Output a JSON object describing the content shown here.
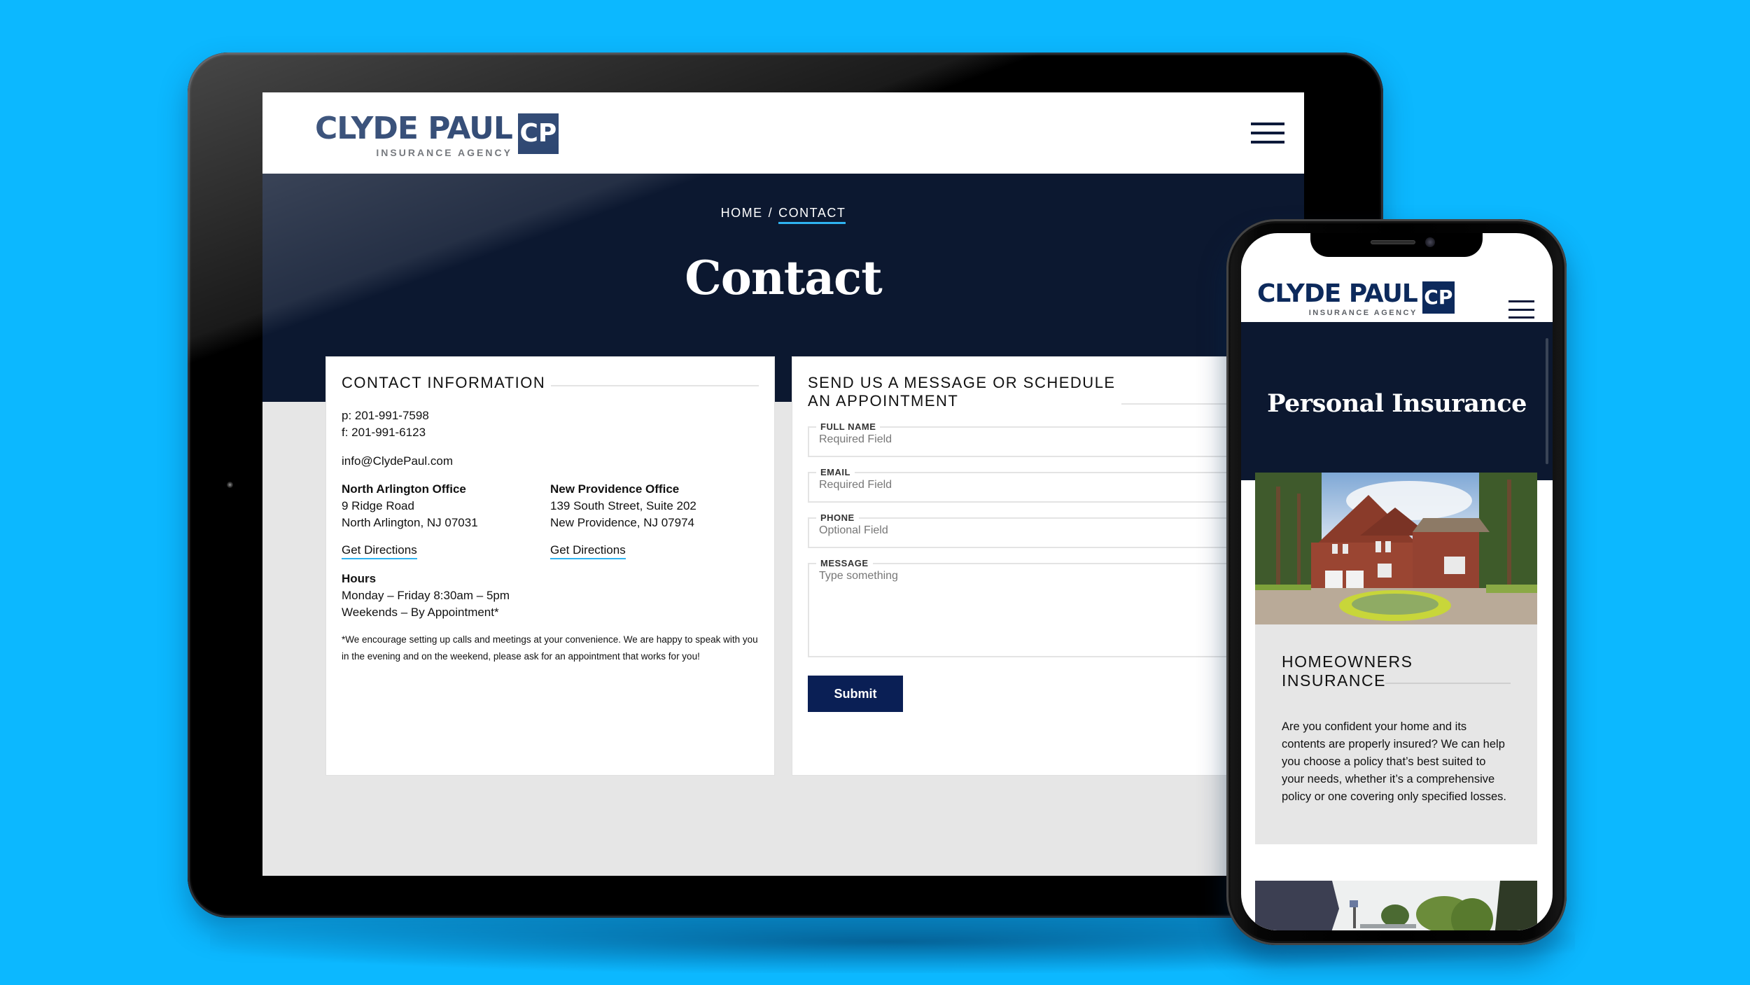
{
  "tablet": {
    "logo": {
      "name": "CLYDE PAUL",
      "subtitle": "INSURANCE AGENCY",
      "mark": "CP"
    },
    "menu_icon": "hamburger-menu-icon",
    "breadcrumb": {
      "home": "HOME",
      "separator": "/",
      "current": "CONTACT"
    },
    "page_title": "Contact",
    "contact_info": {
      "heading": "CONTACT INFORMATION",
      "phone": "p: 201-991-7598",
      "fax": "f: 201-991-6123",
      "email": "info@ClydePaul.com",
      "offices": [
        {
          "name": "North Arlington Office",
          "line1": "9 Ridge Road",
          "line2": "North Arlington, NJ 07031",
          "link": "Get Directions"
        },
        {
          "name": "New Providence Office",
          "line1": "139 South Street, Suite 202",
          "line2": "New Providence, NJ 07974",
          "link": "Get Directions"
        }
      ],
      "hours": {
        "title": "Hours",
        "weekday": "Monday – Friday 8:30am – 5pm",
        "weekend": "Weekends – By Appointment*"
      },
      "note": "*We encourage setting up calls and meetings at your convenience. We are happy to speak with you in the evening and on the weekend, please ask for an appointment that works for you!"
    },
    "form": {
      "heading": "SEND US A MESSAGE OR SCHEDULE AN APPOINTMENT",
      "fields": [
        {
          "label": "FULL NAME",
          "placeholder": "Required Field",
          "value": ""
        },
        {
          "label": "EMAIL",
          "placeholder": "Required Field",
          "value": ""
        },
        {
          "label": "PHONE",
          "placeholder": "Optional Field",
          "value": ""
        },
        {
          "label": "MESSAGE",
          "placeholder": "Type something",
          "value": ""
        }
      ],
      "submit_label": "Submit"
    }
  },
  "phone": {
    "logo": {
      "name": "CLYDE PAUL",
      "subtitle": "INSURANCE AGENCY",
      "mark": "CP"
    },
    "menu_icon": "hamburger-menu-icon",
    "page_title": "Personal Insurance",
    "card": {
      "image": "brick-house-photo",
      "title": "HOMEOWNERS INSURANCE",
      "text": "Are you confident your home and its contents are properly insured? We can help you choose a policy that’s best suited to your needs, whether it’s a comprehensive policy or one covering only specified losses."
    },
    "next_image": "coastal-road-photo"
  },
  "colors": {
    "background": "#0cb8ff",
    "brand_navy": "#0d2a5c",
    "hero_navy": "#0c1830",
    "accent_blue": "#2fb3f0",
    "button_navy": "#0a1f55",
    "page_gray": "#e6e6e6"
  }
}
